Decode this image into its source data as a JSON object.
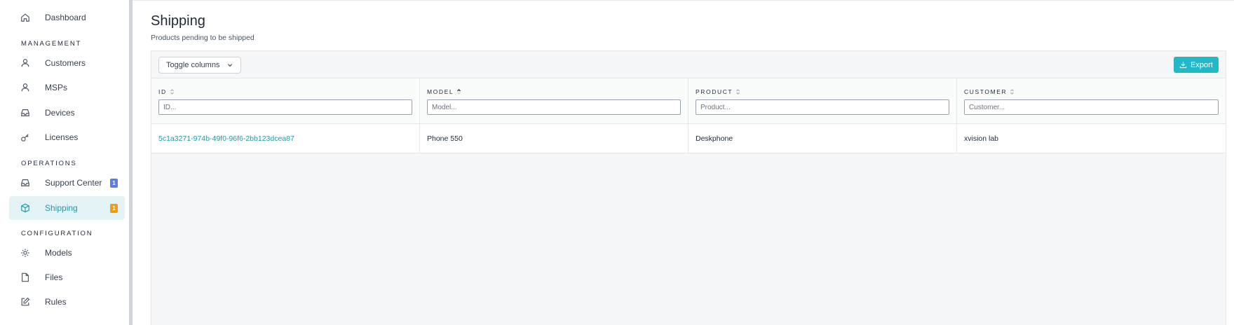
{
  "sidebar": {
    "top_items": [
      {
        "label": "Dashboard",
        "icon": "home-icon"
      }
    ],
    "sections": [
      {
        "title": "MANAGEMENT",
        "items": [
          {
            "label": "Customers",
            "icon": "user-icon"
          },
          {
            "label": "MSPs",
            "icon": "user-icon"
          },
          {
            "label": "Devices",
            "icon": "inbox-icon"
          },
          {
            "label": "Licenses",
            "icon": "key-icon"
          }
        ]
      },
      {
        "title": "OPERATIONS",
        "items": [
          {
            "label": "Support Center",
            "icon": "inbox-icon",
            "badge": "1",
            "badge_color": "#5b7cf0"
          },
          {
            "label": "Shipping",
            "icon": "box-icon",
            "badge": "1",
            "badge_color": "#f39c12",
            "active": true
          }
        ]
      },
      {
        "title": "CONFIGURATION",
        "items": [
          {
            "label": "Models",
            "icon": "gear-icon"
          },
          {
            "label": "Files",
            "icon": "file-icon"
          },
          {
            "label": "Rules",
            "icon": "edit-icon"
          }
        ]
      }
    ]
  },
  "page": {
    "title": "Shipping",
    "subtitle": "Products pending to be shipped"
  },
  "toolbar": {
    "toggle_label": "Toggle columns",
    "export_label": "Export"
  },
  "table": {
    "columns": [
      {
        "label": "ID",
        "placeholder": "ID...",
        "sort": "none"
      },
      {
        "label": "MODEL",
        "placeholder": "Model...",
        "sort": "asc"
      },
      {
        "label": "PRODUCT",
        "placeholder": "Product...",
        "sort": "none"
      },
      {
        "label": "CUSTOMER",
        "placeholder": "Customer...",
        "sort": "none"
      }
    ],
    "rows": [
      [
        "5c1a3271-974b-49f0-96f6-2bb123dcea87",
        "Phone 550",
        "Deskphone",
        "xvision lab"
      ]
    ]
  },
  "colors": {
    "accent": "#1f9aa8",
    "export_button": "#22b8c7",
    "active_bg": "#e3f3f6"
  }
}
